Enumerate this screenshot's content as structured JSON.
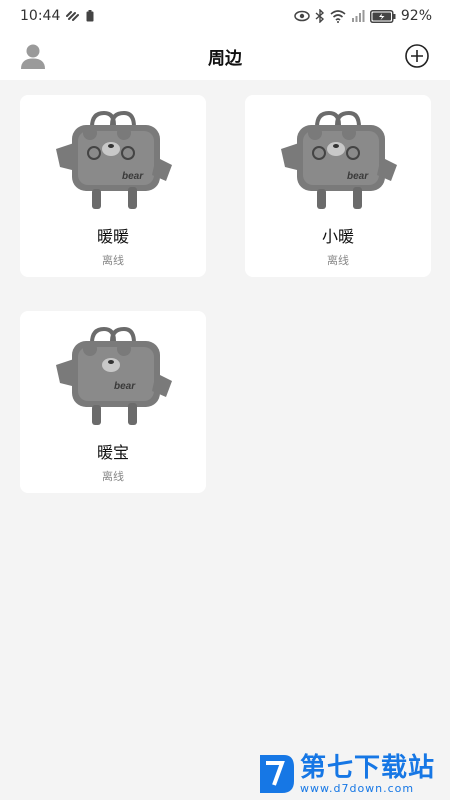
{
  "status_bar": {
    "time": "10:44",
    "battery_percent": "92%"
  },
  "header": {
    "title": "周边"
  },
  "devices": [
    {
      "name": "暖暖",
      "status": "离线",
      "image_label": "bear"
    },
    {
      "name": "小暖",
      "status": "离线",
      "image_label": "bear"
    },
    {
      "name": "暖宝",
      "status": "离线",
      "image_label": "bear"
    }
  ],
  "watermark": {
    "title": "第七下载站",
    "url": "www.d7down.com"
  },
  "colors": {
    "background": "#f4f4f4",
    "card": "#ffffff",
    "watermark": "#1677e5"
  }
}
